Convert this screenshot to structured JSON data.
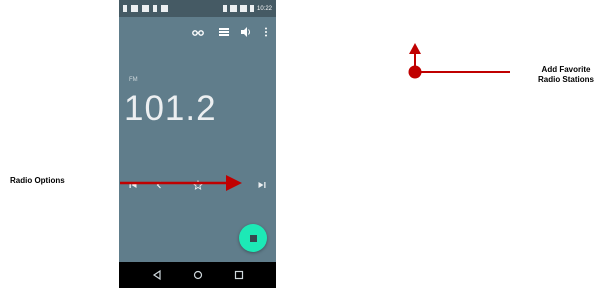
{
  "status_bar": {
    "time": "10:22"
  },
  "radio": {
    "band": "FM",
    "frequency": "101.2"
  },
  "annotations": {
    "radio_options": "Radio Options",
    "add_favorite_line1": "Add Favorite",
    "add_favorite_line2": "Radio Stations"
  },
  "colors": {
    "screen": "#607d8b",
    "fab": "#1de9b6",
    "annotation_arrow": "#c00000"
  },
  "icons": {
    "toolbar": [
      "headset-icon",
      "list-icon",
      "speaker-icon",
      "more-vert-icon"
    ],
    "controls": [
      "skip-previous-icon",
      "chevron-left-icon",
      "star-outline-icon",
      "skip-next-icon"
    ],
    "fab": "stop-icon",
    "nav": [
      "back-icon",
      "home-icon",
      "recents-icon"
    ]
  }
}
